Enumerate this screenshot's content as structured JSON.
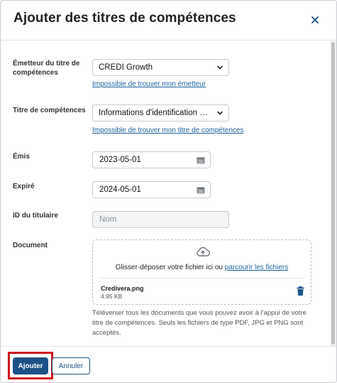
{
  "dialog": {
    "title": "Ajouter des titres de compétences",
    "close_icon": "close-icon"
  },
  "form": {
    "issuer": {
      "label": "Émetteur du titre de compétences",
      "value": "CREDI Growth",
      "link": "Impossible de trouver mon émetteur"
    },
    "credential": {
      "label": "Titre de compétences",
      "value": "Informations d'identification vérifiables",
      "link": "Impossible de trouver mon titre de compétences"
    },
    "issued": {
      "label": "Émis",
      "value": "2023-05-01"
    },
    "expires": {
      "label": "Expiré",
      "value": "2024-05-01"
    },
    "holder_id": {
      "label": "ID du titulaire",
      "placeholder": "Nom"
    },
    "document": {
      "label": "Document",
      "drop_text": "Glisser-déposer votre fichier ici ou ",
      "browse_link": "parcourir les fichiers",
      "file_name": "Credivera.png",
      "file_size": "4.95 KB",
      "help": "Téléverser tous les documents que vous pouvez avoir à l'appui de votre titre de compétences. Seuls les fichiers de type PDF, JPG et PNG sont acceptés."
    }
  },
  "footer": {
    "add_label": "Ajouter",
    "cancel_label": "Annuler"
  },
  "colors": {
    "primary": "#1c5287",
    "link": "#1e5f9c",
    "highlight": "#d0141c"
  }
}
